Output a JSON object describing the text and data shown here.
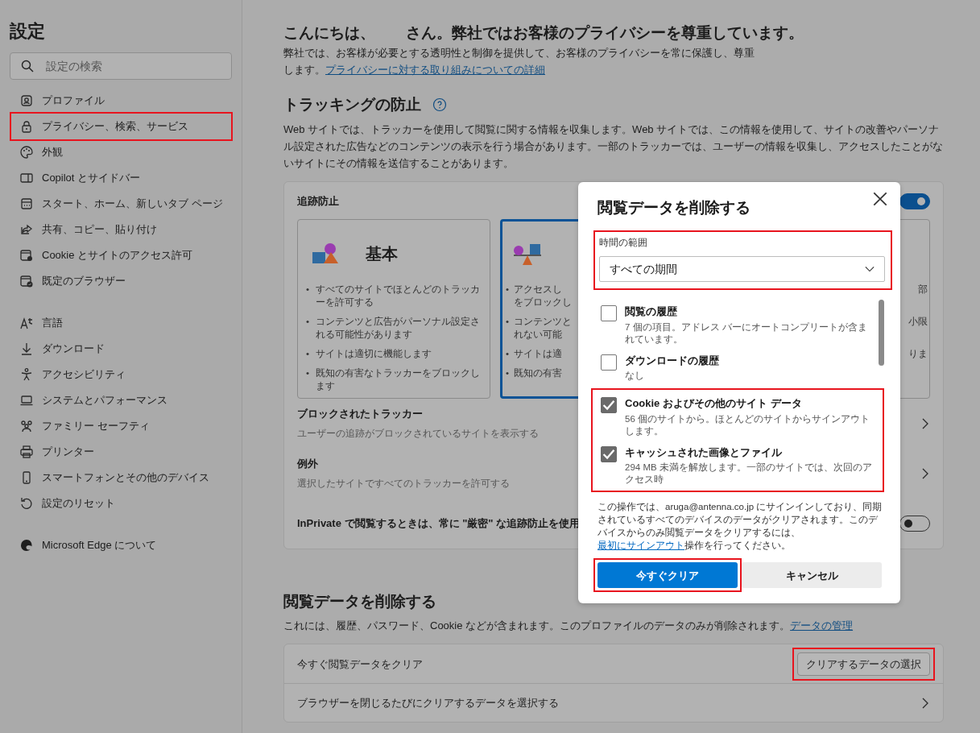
{
  "sidebar": {
    "title": "設定",
    "search": {
      "placeholder": "設定の検索"
    },
    "groups": [
      [
        {
          "label": "プロファイル",
          "highlighted": false
        },
        {
          "label": "プライバシー、検索、サービス",
          "highlighted": true
        },
        {
          "label": "外観",
          "highlighted": false
        },
        {
          "label": "Copilot とサイドバー",
          "highlighted": false
        },
        {
          "label": "スタート、ホーム、新しいタブ ページ",
          "highlighted": false
        },
        {
          "label": "共有、コピー、貼り付け",
          "highlighted": false
        },
        {
          "label": "Cookie とサイトのアクセス許可",
          "highlighted": false
        },
        {
          "label": "既定のブラウザー",
          "highlighted": false
        }
      ],
      [
        {
          "label": "言語",
          "highlighted": false
        },
        {
          "label": "ダウンロード",
          "highlighted": false
        },
        {
          "label": "アクセシビリティ",
          "highlighted": false
        },
        {
          "label": "システムとパフォーマンス",
          "highlighted": false
        },
        {
          "label": "ファミリー セーフティ",
          "highlighted": false
        },
        {
          "label": "プリンター",
          "highlighted": false
        },
        {
          "label": "スマートフォンとその他のデバイス",
          "highlighted": false
        },
        {
          "label": "設定のリセット",
          "highlighted": false
        }
      ],
      [
        {
          "label": "Microsoft Edge について",
          "highlighted": false
        }
      ]
    ]
  },
  "main": {
    "greeting": "こんにちは、　　さん。弊社ではお客様のプライバシーを尊重しています。",
    "intro": {
      "text": "弊社では、お客様が必要とする透明性と制御を提供して、お客様のプライバシーを常に保護し、尊重します。",
      "link": "プライバシーに対する取り組みについての詳細"
    },
    "tracking": {
      "title": "トラッキングの防止",
      "description": "Web サイトでは、トラッカーを使用して閲覧に関する情報を収集します。Web サイトでは、この情報を使用して、サイトの改善やパーソナル設定された広告などのコンテンツの表示を行う場合があります。一部のトラッカーでは、ユーザーの情報を収集し、アクセスしたことがないサイトにその情報を送信することがあります。",
      "card": {
        "label": "追跡防止",
        "on": true,
        "options": [
          {
            "kind": "full",
            "title": "基本",
            "selected": false,
            "bullets": [
              {
                "marker": "•",
                "text": "すべてのサイトでほとんどのトラッカーを許可する"
              },
              {
                "marker": "•",
                "text": "コンテンツと広告がパーソナル設定される可能性があります"
              },
              {
                "marker": "•",
                "text": "サイトは適切に機能します"
              },
              {
                "marker": "•",
                "text": "既知の有害なトラッカーをブロックします"
              }
            ]
          },
          {
            "kind": "left_part",
            "selected": true,
            "bullets": [
              {
                "marker": "•",
                "text": "アクセスし"
              },
              {
                "text": "をブロックし"
              },
              {
                "marker": "•",
                "text": "コンテンツと"
              },
              {
                "text": "れない可能"
              },
              {
                "marker": "•",
                "text": "サイトは適"
              },
              {
                "marker": "•",
                "text": "既知の有害"
              }
            ]
          },
          {
            "kind": "right_part",
            "selected": false,
            "bullets": [
              {
                "text": "部"
              },
              {
                "text": "小限"
              },
              {
                "text": "りま"
              }
            ]
          }
        ],
        "rows": [
          {
            "kind": "link",
            "title": "ブロックされたトラッカー",
            "subtitle": "ユーザーの追跡がブロックされているサイトを表示する"
          },
          {
            "kind": "link",
            "title": "例外",
            "subtitle": "選択したサイトですべてのトラッカーを許可する"
          },
          {
            "kind": "toggle",
            "title": "InPrivate で閲覧するときは、常に \"厳密\" な追跡防止を使用",
            "on": false
          }
        ]
      }
    },
    "clear": {
      "title": "閲覧データを削除する",
      "description": "これには、履歴、パスワード、Cookie などが含まれます。このプロファイルのデータのみが削除されます。",
      "link": "データの管理",
      "rows": [
        {
          "kind": "button",
          "title": "今すぐ閲覧データをクリア",
          "button": "クリアするデータの選択",
          "highlighted": true
        },
        {
          "kind": "link",
          "title": "ブラウザーを閉じるたびにクリアするデータを選択する"
        }
      ]
    }
  },
  "dialog": {
    "title": "閲覧データを削除する",
    "time_range": {
      "label": "時間の範囲",
      "value": "すべての期間",
      "highlighted": true
    },
    "items": [
      {
        "title": "閲覧の履歴",
        "detail": "7 個の項目。アドレス バーにオートコンプリートが含まれています。",
        "checked": false,
        "highlighted": false
      },
      {
        "title": "ダウンロードの履歴",
        "detail": "なし",
        "checked": false,
        "highlighted": false
      },
      {
        "title": "Cookie およびその他のサイト データ",
        "detail": "56 個のサイトから。ほとんどのサイトからサインアウトします。",
        "checked": true,
        "highlighted": true
      },
      {
        "title": "キャッシュされた画像とファイル",
        "detail": "294 MB 未満を解放します。一部のサイトでは、次回のアクセス時",
        "checked": true,
        "highlighted": true
      }
    ],
    "notice": {
      "before": "この操作では、aruga@antenna.co.jp にサインインしており、同期されているすべてのデバイスのデータがクリアされます。このデバイスからのみ閲覧データをクリアするには、",
      "link": "最初にサインアウト",
      "after": "操作を行ってください。"
    },
    "buttons": [
      {
        "label": "今すぐクリア",
        "kind": "primary",
        "highlighted": true
      },
      {
        "label": "キャンセル",
        "kind": "secondary",
        "highlighted": false
      }
    ]
  }
}
